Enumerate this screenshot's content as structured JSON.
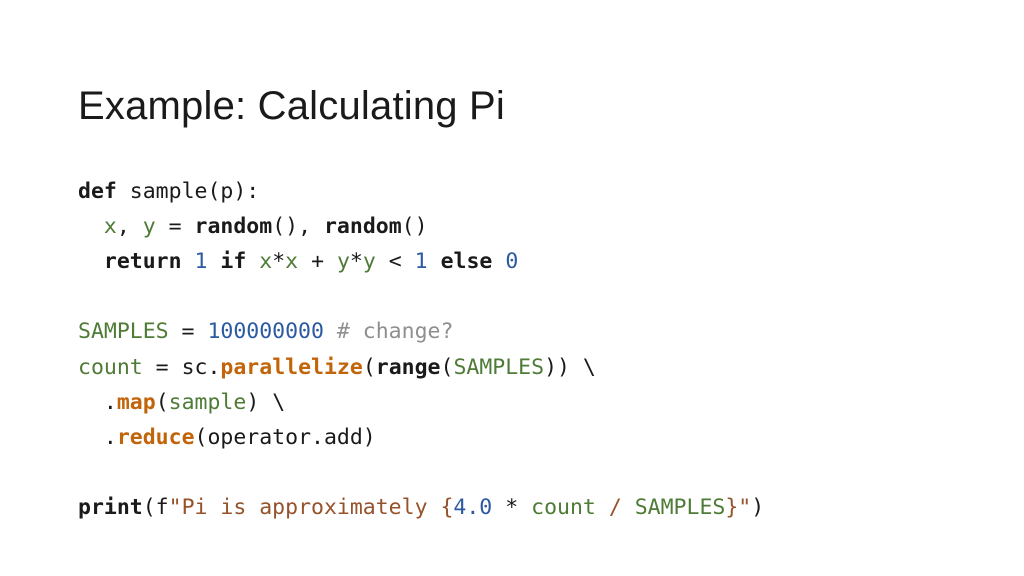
{
  "slide": {
    "title": "Example: Calculating Pi",
    "background_color": "#ffffff",
    "title_color": "#1a1a1a"
  },
  "palette": {
    "plain": "#1a1a1a",
    "keyword": "#1a1a1a",
    "builtin": "#1a1a1a",
    "name": "#4e7b36",
    "number": "#2c5aa0",
    "comment": "#8f8f8f",
    "function": "#c1640a",
    "string": "#96522a",
    "brace": "#96522a"
  },
  "code": {
    "language": "python",
    "full_text": "def sample(p):\n  x, y = random(), random()\n  return 1 if x*x + y*y < 1 else 0\n\nSAMPLES = 100000000 # change?\ncount = sc.parallelize(range(SAMPLES)) \\\n  .map(sample) \\\n  .reduce(operator.add)\n\nprint(f\"Pi is approximately {4.0 * count / SAMPLES}\")",
    "lines": [
      {
        "id": "line-1",
        "text": "def sample(p):",
        "tokens": [
          {
            "t": "def",
            "c": "keyword"
          },
          {
            "t": " ",
            "c": "plain"
          },
          {
            "t": "sample",
            "c": "plain"
          },
          {
            "t": "(p):",
            "c": "plain"
          }
        ]
      },
      {
        "id": "line-2",
        "text": "  x, y = random(), random()",
        "tokens": [
          {
            "t": "  ",
            "c": "plain"
          },
          {
            "t": "x",
            "c": "name"
          },
          {
            "t": ", ",
            "c": "plain"
          },
          {
            "t": "y",
            "c": "name"
          },
          {
            "t": " = ",
            "c": "plain"
          },
          {
            "t": "random",
            "c": "builtin"
          },
          {
            "t": "(), ",
            "c": "plain"
          },
          {
            "t": "random",
            "c": "builtin"
          },
          {
            "t": "()",
            "c": "plain"
          }
        ]
      },
      {
        "id": "line-3",
        "text": "  return 1 if x*x + y*y < 1 else 0",
        "tokens": [
          {
            "t": "  ",
            "c": "plain"
          },
          {
            "t": "return",
            "c": "keyword"
          },
          {
            "t": " ",
            "c": "plain"
          },
          {
            "t": "1",
            "c": "number"
          },
          {
            "t": " ",
            "c": "plain"
          },
          {
            "t": "if",
            "c": "keyword"
          },
          {
            "t": " ",
            "c": "plain"
          },
          {
            "t": "x",
            "c": "name"
          },
          {
            "t": "*",
            "c": "plain"
          },
          {
            "t": "x",
            "c": "name"
          },
          {
            "t": " + ",
            "c": "plain"
          },
          {
            "t": "y",
            "c": "name"
          },
          {
            "t": "*",
            "c": "plain"
          },
          {
            "t": "y",
            "c": "name"
          },
          {
            "t": " < ",
            "c": "plain"
          },
          {
            "t": "1",
            "c": "number"
          },
          {
            "t": " ",
            "c": "plain"
          },
          {
            "t": "else",
            "c": "keyword"
          },
          {
            "t": " ",
            "c": "plain"
          },
          {
            "t": "0",
            "c": "number"
          }
        ]
      },
      {
        "id": "line-4",
        "text": "",
        "tokens": []
      },
      {
        "id": "line-5",
        "text": "SAMPLES = 100000000 # change?",
        "tokens": [
          {
            "t": "SAMPLES",
            "c": "name"
          },
          {
            "t": " = ",
            "c": "plain"
          },
          {
            "t": "100000000",
            "c": "number"
          },
          {
            "t": " ",
            "c": "plain"
          },
          {
            "t": "# change?",
            "c": "comment"
          }
        ]
      },
      {
        "id": "line-6",
        "text": "count = sc.parallelize(range(SAMPLES)) \\",
        "tokens": [
          {
            "t": "count",
            "c": "name"
          },
          {
            "t": " = ",
            "c": "plain"
          },
          {
            "t": "sc.",
            "c": "plain"
          },
          {
            "t": "parallelize",
            "c": "function"
          },
          {
            "t": "(",
            "c": "plain"
          },
          {
            "t": "range",
            "c": "builtin"
          },
          {
            "t": "(",
            "c": "plain"
          },
          {
            "t": "SAMPLES",
            "c": "name"
          },
          {
            "t": ")) \\",
            "c": "plain"
          }
        ]
      },
      {
        "id": "line-7",
        "text": "  .map(sample) \\",
        "tokens": [
          {
            "t": "  .",
            "c": "plain"
          },
          {
            "t": "map",
            "c": "function"
          },
          {
            "t": "(",
            "c": "plain"
          },
          {
            "t": "sample",
            "c": "name"
          },
          {
            "t": ") \\",
            "c": "plain"
          }
        ]
      },
      {
        "id": "line-8",
        "text": "  .reduce(operator.add)",
        "tokens": [
          {
            "t": "  .",
            "c": "plain"
          },
          {
            "t": "reduce",
            "c": "function"
          },
          {
            "t": "(operator.add)",
            "c": "plain"
          }
        ]
      },
      {
        "id": "line-9",
        "text": "",
        "tokens": []
      },
      {
        "id": "line-10",
        "text": "print(f\"Pi is approximately {4.0 * count / SAMPLES}\")",
        "tokens": [
          {
            "t": "print",
            "c": "builtin"
          },
          {
            "t": "(f",
            "c": "plain"
          },
          {
            "t": "\"",
            "c": "string"
          },
          {
            "t": "Pi is approximately ",
            "c": "string"
          },
          {
            "t": "{",
            "c": "brace"
          },
          {
            "t": "4.0",
            "c": "number"
          },
          {
            "t": " ",
            "c": "plain"
          },
          {
            "t": "*",
            "c": "plain"
          },
          {
            "t": " ",
            "c": "plain"
          },
          {
            "t": "count",
            "c": "name"
          },
          {
            "t": " ",
            "c": "plain"
          },
          {
            "t": "/",
            "c": "brace"
          },
          {
            "t": " ",
            "c": "plain"
          },
          {
            "t": "SAMPLES",
            "c": "name"
          },
          {
            "t": "}",
            "c": "brace"
          },
          {
            "t": "\"",
            "c": "string"
          },
          {
            "t": ")",
            "c": "plain"
          }
        ]
      }
    ]
  }
}
